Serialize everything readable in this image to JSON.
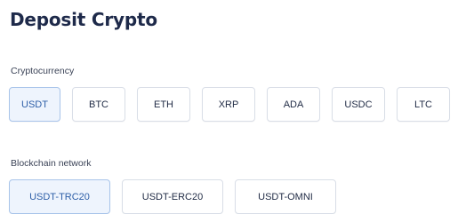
{
  "page": {
    "title": "Deposit Crypto"
  },
  "cryptocurrency": {
    "label": "Cryptocurrency",
    "selected": "USDT",
    "options": [
      "USDT",
      "BTC",
      "ETH",
      "XRP",
      "ADA",
      "USDC",
      "LTC"
    ]
  },
  "network": {
    "label": "Blockchain network",
    "selected": "USDT-TRC20",
    "options": [
      "USDT-TRC20",
      "USDT-ERC20",
      "USDT-OMNI"
    ]
  },
  "colors": {
    "selected_border": "#a8c4ea",
    "selected_background": "#eef4fd",
    "selected_text": "#2e5fa8",
    "default_border": "#d9dee7"
  }
}
